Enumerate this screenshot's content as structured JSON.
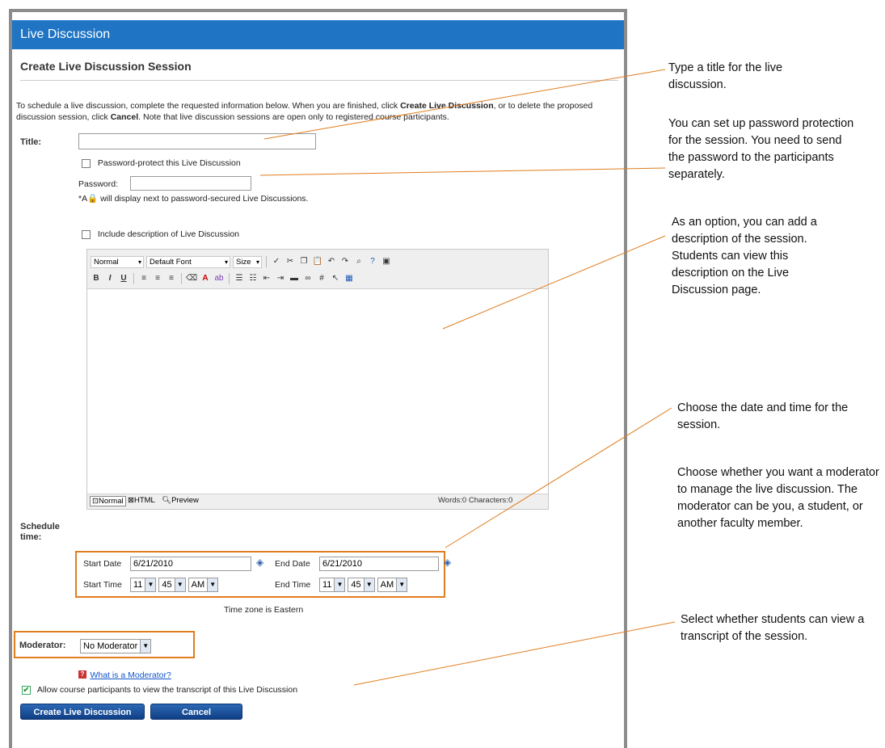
{
  "window": {
    "title": "Live Discussion"
  },
  "page": {
    "subtitle": "Create Live Discussion Session",
    "intro_1": "To schedule a live discussion, complete the requested information below. When you are finished, click ",
    "intro_bold_1": "Create Live Discussion",
    "intro_2": ", or to delete the proposed discussion session, click ",
    "intro_bold_2": "Cancel",
    "intro_3": ". Note that live discussion sessions are open only to registered course participants."
  },
  "form": {
    "title_label": "Title:",
    "title_value": "",
    "password_protect_label": "Password-protect this Live Discussion",
    "password_protect_checked": false,
    "password_label": "Password:",
    "password_value": "",
    "password_note_prefix": "*A",
    "password_note_suffix": "will display next to password-secured Live Discussions.",
    "description_label": "Include description of Live Discussion",
    "description_checked": false,
    "schedule_label": "Schedule time:",
    "start_date_label": "Start Date",
    "start_date_value": "6/21/2010",
    "end_date_label": "End Date",
    "end_date_value": "6/21/2010",
    "start_time_label": "Start Time",
    "end_time_label": "End Time",
    "start_hour": "11",
    "start_minute": "45",
    "start_ampm": "AM",
    "end_hour": "11",
    "end_minute": "45",
    "end_ampm": "AM",
    "timezone_note": "Time zone is Eastern",
    "moderator_label": "Moderator:",
    "moderator_value": "No Moderator",
    "moderator_help_link": "What is a Moderator?",
    "transcript_label": "Allow course participants to view the transcript of this Live Discussion",
    "transcript_checked": true,
    "create_button": "Create Live Discussion",
    "cancel_button": "Cancel"
  },
  "editor": {
    "paragraph_select": "Normal",
    "font_select": "Default Font",
    "size_select": "Size",
    "mode_normal": "Normal",
    "mode_html": "HTML",
    "mode_preview": "Preview",
    "counts": "Words:0 Characters:0"
  },
  "annotations": {
    "title": "Type a title for the live discussion.",
    "password": "You can set up password protection for the session. You need to send the password to the participants separately.",
    "description": "As an option, you can add a description of the session. Students can view this description on the Live Discussion page.",
    "schedule": "Choose the date and time for the session.",
    "moderator": "Choose whether you want a moderator to manage the live discussion. The moderator can be you, a student, or another faculty member.",
    "transcript": "Select whether students can view a transcript of the session."
  },
  "colors": {
    "titlebar": "#1f74c4",
    "callout": "#e07d1e",
    "button": "#1a4f9c"
  }
}
